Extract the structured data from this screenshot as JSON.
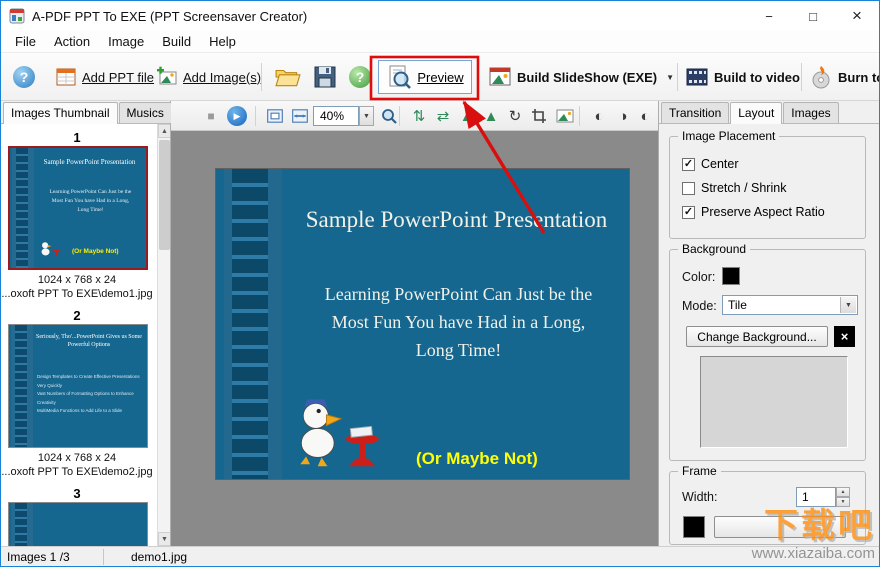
{
  "window": {
    "title": "A-PDF PPT To EXE (PPT Screensaver Creator)",
    "controls": {
      "minimize": "−",
      "maximize": "□",
      "close": "×"
    }
  },
  "menu": {
    "items": [
      "File",
      "Action",
      "Image",
      "Build",
      "Help"
    ]
  },
  "toolbar": {
    "help1": "?",
    "add_ppt_label": "Add PPT file",
    "add_images_label": "Add Image(s)",
    "help2": "?",
    "preview_label": "Preview",
    "build_slideshow_label": "Build SlideShow (EXE)",
    "build_video_label": "Build to video",
    "burn_label": "Burn to"
  },
  "left_panel": {
    "tabs": [
      "Images Thumbnail",
      "Musics"
    ],
    "thumbnails": [
      {
        "index": "1",
        "size": "1024 x 768 x 24",
        "path": "...oxoft PPT To EXE\\demo1.jpg"
      },
      {
        "index": "2",
        "size": "1024 x 768 x 24",
        "path": "...oxoft PPT To EXE\\demo2.jpg"
      },
      {
        "index": "3",
        "size": "",
        "path": ""
      }
    ]
  },
  "viewer": {
    "zoom": "40%",
    "slide1": {
      "title": "Sample PowerPoint Presentation",
      "body_lines": [
        "Learning PowerPoint Can Just be the",
        "Most Fun You have Had in a Long,",
        "Long Time!"
      ],
      "note": "(Or Maybe Not)"
    },
    "slide2": {
      "title": "Seriously, Tho'...PowerPoint Gives us Some Powerful Options",
      "bullets": [
        "Design Templates to Create Effective Presentations Very Quickly",
        "Vast Numbers of Formatting Options to Enhance Creativity",
        "MultiMedia Functions to Add Life to a Slide"
      ]
    }
  },
  "right_panel": {
    "tabs": [
      "Transition",
      "Layout",
      "Images"
    ],
    "image_placement": {
      "title": "Image Placement",
      "options": [
        {
          "label": "Center",
          "checked": true
        },
        {
          "label": "Stretch / Shrink",
          "checked": false
        },
        {
          "label": "Preserve Aspect Ratio",
          "checked": true
        }
      ]
    },
    "background": {
      "title": "Background",
      "color_label": "Color:",
      "mode_label": "Mode:",
      "mode_value": "Tile",
      "change_button": "Change Background...",
      "close_glyph": "×"
    },
    "frame": {
      "title": "Frame",
      "width_label": "Width:",
      "width_value": "1"
    }
  },
  "status": {
    "images": "Images 1 /3",
    "file": "demo1.jpg"
  },
  "watermark": {
    "line1": "下载吧",
    "line2": "www.xiazaiba.com"
  },
  "icons": {
    "play": "▶",
    "stop": "■",
    "rotate": "↻",
    "flip_v": "⇅",
    "flip_h": "⇄",
    "mountain": "▲",
    "contrast_a": "◐",
    "contrast_b": "◑",
    "check": "✓",
    "up": "▲",
    "down": "▼"
  },
  "colors": {
    "slide_blue": "#16678f",
    "annotation_red": "#e00b0b",
    "selection_red": "#9b1c1c"
  }
}
